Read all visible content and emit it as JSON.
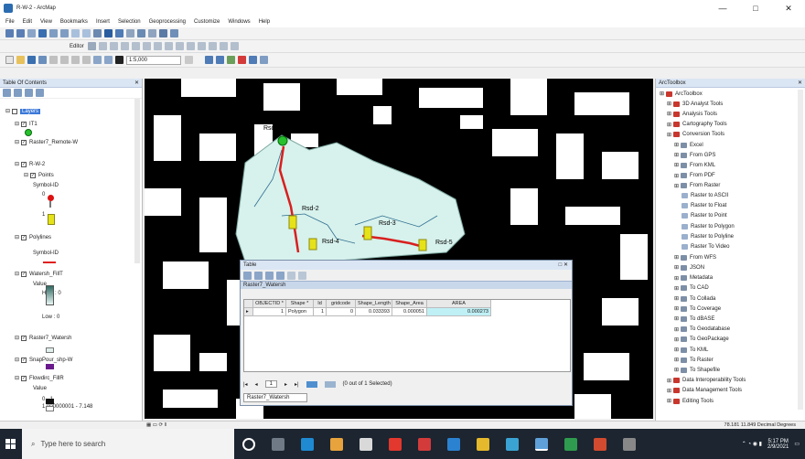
{
  "window": {
    "title": "R-W-2 - ArcMap",
    "controls": [
      "—",
      "□",
      "✕"
    ]
  },
  "menu": [
    "File",
    "Edit",
    "View",
    "Bookmarks",
    "Insert",
    "Selection",
    "Geoprocessing",
    "Customize",
    "Windows",
    "Help"
  ],
  "toolbar": {
    "scale_value": "1:5,000",
    "editor_label": "Editor"
  },
  "toc": {
    "title": "Table Of Contents",
    "layers": [
      {
        "label": "Layers",
        "indent": 0,
        "checked": false,
        "selected": true
      },
      {
        "label": "IT1",
        "indent": 1,
        "checked": true
      },
      {
        "label": "Raster7_Remote-W",
        "indent": 1,
        "checked": true
      },
      {
        "label": "R-W-2",
        "indent": 1,
        "checked": true
      },
      {
        "label": "Points",
        "indent": 2,
        "checked": true
      },
      {
        "label": "Symbol-ID",
        "indent": 3,
        "checked": false
      },
      {
        "label": "0",
        "indent": 4,
        "checked": false
      },
      {
        "label": "1",
        "indent": 4,
        "checked": false
      },
      {
        "label": "Polylines",
        "indent": 1,
        "checked": true
      },
      {
        "label": "Symbol-ID",
        "indent": 3,
        "checked": false
      },
      {
        "label": "Watersh_FillT",
        "indent": 1,
        "checked": true
      },
      {
        "label": "Value",
        "indent": 3,
        "checked": false
      },
      {
        "label": "High : 0",
        "indent": 4,
        "checked": false
      },
      {
        "label": "Low : 0",
        "indent": 4,
        "checked": false
      },
      {
        "label": "Raster7_Watersh",
        "indent": 1,
        "checked": true
      },
      {
        "label": "SnapPour_shp-W",
        "indent": 1,
        "checked": true
      },
      {
        "label": "Flowdirc_FillR",
        "indent": 1,
        "checked": true
      },
      {
        "label": "Value",
        "indent": 3,
        "checked": false
      },
      {
        "label": "0 - 1",
        "indent": 4,
        "checked": false
      },
      {
        "label": "1.000000001 - 7.148",
        "indent": 4,
        "checked": false
      }
    ]
  },
  "map": {
    "labels": [
      "Rsd-1",
      "Rsd-2",
      "Rsd-3",
      "Rsd-4",
      "Rsd-5"
    ]
  },
  "toolbox": {
    "title": "ArcToolbox",
    "items": [
      {
        "label": "ArcToolbox",
        "indent": 0
      },
      {
        "label": "3D Analyst Tools",
        "indent": 1
      },
      {
        "label": "Analysis Tools",
        "indent": 1
      },
      {
        "label": "Cartography Tools",
        "indent": 1
      },
      {
        "label": "Conversion Tools",
        "indent": 1
      },
      {
        "label": "Excel",
        "indent": 2
      },
      {
        "label": "From GPS",
        "indent": 2
      },
      {
        "label": "From KML",
        "indent": 2
      },
      {
        "label": "From PDF",
        "indent": 2
      },
      {
        "label": "From Raster",
        "indent": 2
      },
      {
        "label": "Raster to ASCII",
        "indent": 3
      },
      {
        "label": "Raster to Float",
        "indent": 3
      },
      {
        "label": "Raster to Point",
        "indent": 3
      },
      {
        "label": "Raster to Polygon",
        "indent": 3
      },
      {
        "label": "Raster to Polyline",
        "indent": 3
      },
      {
        "label": "Raster To Video",
        "indent": 3
      },
      {
        "label": "From WFS",
        "indent": 2
      },
      {
        "label": "JSON",
        "indent": 2
      },
      {
        "label": "Metadata",
        "indent": 2
      },
      {
        "label": "To CAD",
        "indent": 2
      },
      {
        "label": "To Collada",
        "indent": 2
      },
      {
        "label": "To Coverage",
        "indent": 2
      },
      {
        "label": "To dBASE",
        "indent": 2
      },
      {
        "label": "To Geodatabase",
        "indent": 2
      },
      {
        "label": "To GeoPackage",
        "indent": 2
      },
      {
        "label": "To KML",
        "indent": 2
      },
      {
        "label": "To Raster",
        "indent": 2
      },
      {
        "label": "To Shapefile",
        "indent": 2
      },
      {
        "label": "Data Interoperability Tools",
        "indent": 1
      },
      {
        "label": "Data Management Tools",
        "indent": 1
      },
      {
        "label": "Editing Tools",
        "indent": 1
      }
    ]
  },
  "table_window": {
    "title": "Table",
    "tab_label": "Raster7_Watersh",
    "columns": [
      "OBJECTID *",
      "Shape *",
      "Id",
      "gridcode",
      "Shape_Length",
      "Shape_Area",
      "AREA"
    ],
    "rows": [
      [
        "1",
        "Polygon",
        "1",
        "0",
        "0.033393",
        "0.000051",
        "0.000273"
      ]
    ],
    "nav_record": "1",
    "selection_text": "(0 out of 1 Selected)",
    "bottom_tab": "Raster7_Watersh"
  },
  "statusbar": {
    "coords": "78.181  11.849 Decimal Degrees"
  },
  "taskbar": {
    "search_placeholder": "Type here to search",
    "time": "5:17 PM",
    "date": "2/9/2021"
  }
}
